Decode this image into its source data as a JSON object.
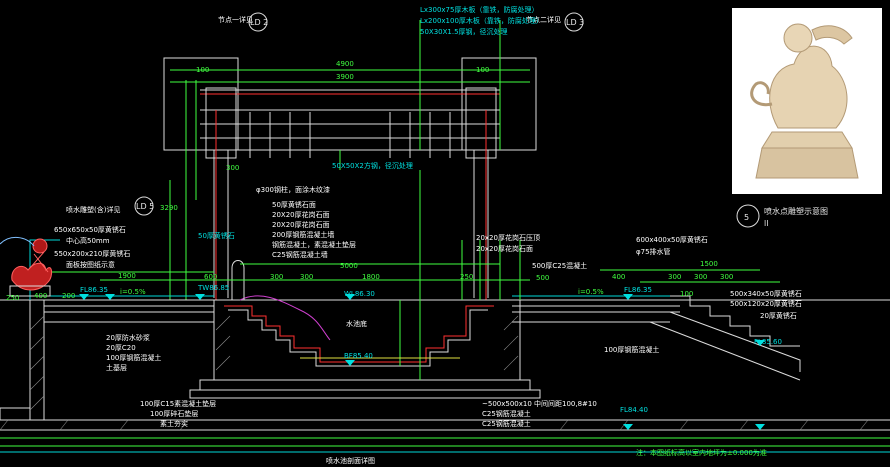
{
  "labels": {
    "node1": "节点一详见",
    "node2": "节点二详见",
    "ld2": "LD 2",
    "ld3": "LD 3",
    "ld5": "LD 5",
    "beam1": "Lx300x75厚木板（靠铁，防腐处理）",
    "beam2": "Lx200x100厚木板（靠铁，防腐处理）",
    "beam3": "50X30X1.5厚钢，径沉处理",
    "tube": "50X50X2方钢，径沉处理",
    "d4900": "4900",
    "d3900": "3900",
    "d5000": "5000",
    "d1800": "1800",
    "d1900": "1900",
    "d1500": "1500",
    "d600": "600",
    "d300": "300",
    "d400": "400",
    "d200": "200",
    "d100": "100",
    "d500": "500",
    "d3290": "3290",
    "d250": "250",
    "fountain": "喷水雕塑(含)详见",
    "stone1": "650x650x50厚黄锈石",
    "stone1b": "中心高50mm",
    "stone2": "550x200x210厚黄锈石",
    "stone2b": "面板按图纸示意",
    "wall1": "φ300钢柱，面涂木纹漆",
    "wall2": "50厚黄锈石面",
    "wall3": "20X20厚花岗石面",
    "wall4": "20X20厚花岗石面",
    "wall5": "200厚钢筋混凝土墙",
    "wall6": "钢筋混凝土，素混凝土垫层",
    "wall7": "C25钢筋混凝土墙",
    "wall8": "50厚黄锈石",
    "right1": "20x20厚花岗石压顶",
    "right2": "20x20厚花岗石面",
    "right3": "500厚C25混凝土",
    "right4": "600x400x50厚黄锈石",
    "right5": "φ75排水管",
    "right6": "500x340x50厚黄锈石",
    "right7": "500x120x20厚黄锈石",
    "right8": "20厚黄锈石",
    "right9": "FL85.60",
    "lvl1": "FL86.35",
    "lvl2": "TW86.85",
    "lvl3": "WL86.30",
    "lvl4": "BF85.40",
    "lvl5": "FL86.35",
    "lvl6": "FL84.40",
    "slope1": "i=0.5%",
    "slope2": "i=0.5%",
    "pool": "水池底",
    "base1": "100厚C15素混凝土垫层",
    "base2": "100厚碎石垫层",
    "base3": "素土夯实",
    "mid1": "20厚防水砂浆",
    "mid2": "20厚C20",
    "mid3": "100厚钢筋混凝土",
    "mid4": "土基层",
    "bot1": "~500x500x10 中间间距100,8#10",
    "bot2": "C25钢筋混凝土",
    "bot3": "C25钢筋混凝土",
    "bot4": "100厚钢筋混凝土",
    "caption": "喷水池剖面详图",
    "note": "注：本图纸标高以室内地坪为±0.000为准",
    "sculptureCaption": "喷水点雕塑示意图",
    "sculptureNum": "5",
    "sculptureSub": "ll"
  }
}
